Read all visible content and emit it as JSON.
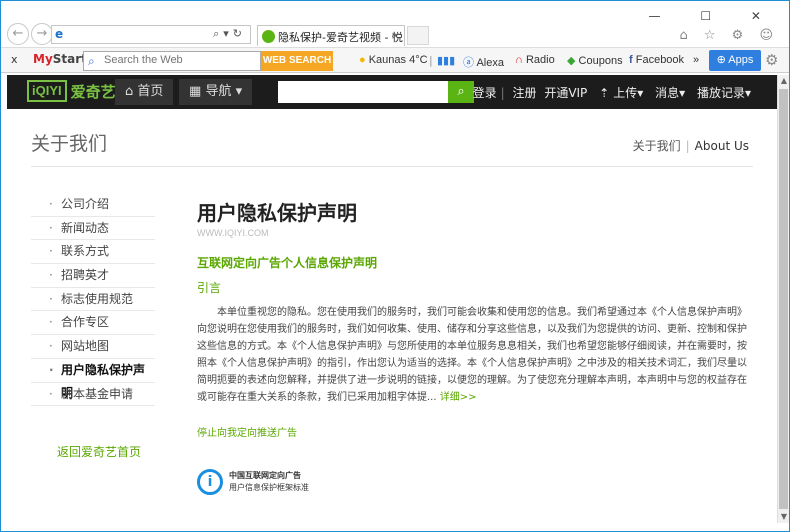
{
  "browser": {
    "tab_title": "隐私保护-爱奇艺视频 - 悦...",
    "window_controls": "—  ☐  ✕",
    "right_icons": "⌂ ☆ ⚙ ☺"
  },
  "toolbar": {
    "close": "x",
    "mystart_my": "My",
    "mystart_start": "Start",
    "search_placeholder": "Search the Web",
    "web_search": "WEB SEARCH",
    "weather": "Kaunas 4°C",
    "alexa": "Alexa",
    "radio": "Radio",
    "coupons": "Coupons",
    "facebook": "Facebook",
    "more": "»",
    "apps": "Apps"
  },
  "header": {
    "logo_mark": "iQIYI",
    "logo_text": "爱奇艺",
    "home": "首页",
    "nav": "导航",
    "links": [
      "登录",
      "注册",
      "开通VIP",
      "上传",
      "消息",
      "播放记录"
    ]
  },
  "page": {
    "title": "关于我们",
    "crumb_cn": "关于我们",
    "crumb_en": "About Us",
    "back_home": "返回爱奇艺首页"
  },
  "sidebar": {
    "items": [
      {
        "label": "公司介绍"
      },
      {
        "label": "新闻动态"
      },
      {
        "label": "联系方式"
      },
      {
        "label": "招聘英才"
      },
      {
        "label": "标志使用规范"
      },
      {
        "label": "合作专区"
      },
      {
        "label": "网站地图"
      },
      {
        "label": "用户隐私保护声明"
      },
      {
        "label": "剧本基金申请"
      }
    ]
  },
  "article": {
    "heading": "用户隐私保护声明",
    "url": "WWW.IQIYI.COM",
    "section_title": "互联网定向广告个人信息保护声明",
    "intro": "引言",
    "paragraph": "本单位重视您的隐私。您在使用我们的服务时，我们可能会收集和使用您的信息。我们希望通过本《个人信息保护声明》向您说明在您使用我们的服务时，我们如何收集、使用、储存和分享这些信息，以及我们为您提供的访问、更新、控制和保护这些信息的方式。本《个人信息保护声明》与您所使用的本单位服务息息相关，我们也希望您能够仔细阅读，并在需要时，按照本《个人信息保护声明》的指引，作出您认为适当的选择。本《个人信息保护声明》之中涉及的相关技术词汇，我们尽量以简明扼要的表述向您解释，并提供了进一步说明的链接，以便您的理解。为了使您充分理解本声明，本声明中与您的权益存在或可能存在重大关系的条款，我们已采用加粗字体提...",
    "more": "详细>>",
    "stop_ad": "停止向我定向推送广告",
    "badge_mark": "i",
    "badge_line1": "中国互联网定向广告",
    "badge_line2": "用户信息保护框架标准"
  }
}
